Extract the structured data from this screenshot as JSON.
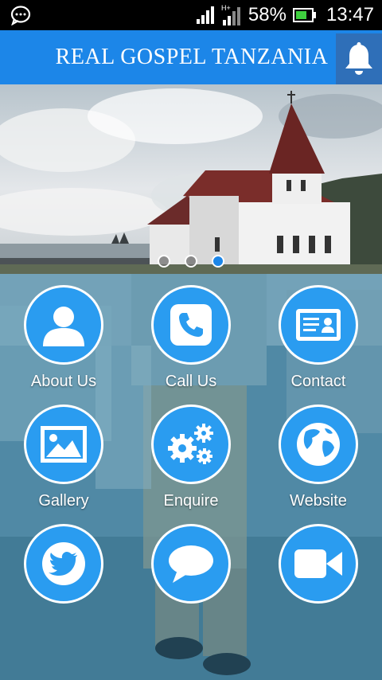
{
  "status_bar": {
    "battery_percent": "58%",
    "time": "13:47",
    "network_type": "H+",
    "icons": [
      "message-icon",
      "signal-icon",
      "signal-icon",
      "battery-icon"
    ]
  },
  "header": {
    "title": "REAL GOSPEL TANZANIA",
    "bell_icon": "bell-icon"
  },
  "slider": {
    "slide_count": 3,
    "active_index": 2
  },
  "colors": {
    "accent": "#1c86e8",
    "tile_circle": "#2a9cf0",
    "status_bar": "#000000"
  },
  "tiles": [
    {
      "label": "About Us",
      "icon": "person-icon"
    },
    {
      "label": "Call Us",
      "icon": "phone-icon"
    },
    {
      "label": "Contact",
      "icon": "contact-card-icon"
    },
    {
      "label": "Gallery",
      "icon": "image-icon"
    },
    {
      "label": "Enquire",
      "icon": "gears-icon"
    },
    {
      "label": "Website",
      "icon": "globe-icon"
    },
    {
      "label": "",
      "icon": "twitter-icon"
    },
    {
      "label": "",
      "icon": "chat-bubble-icon"
    },
    {
      "label": "",
      "icon": "video-camera-icon"
    }
  ]
}
